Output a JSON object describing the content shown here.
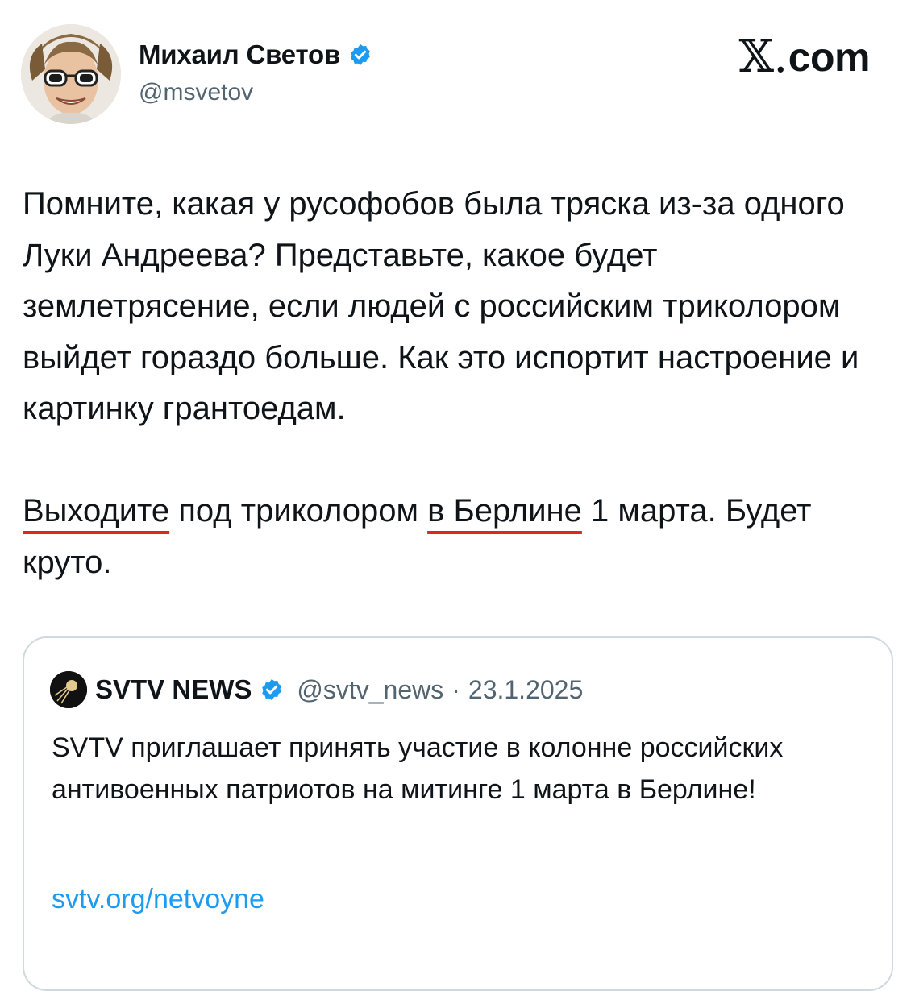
{
  "author": {
    "name": "Михаил Светов",
    "handle": "@msvetov",
    "avatar_icon": "avatar-photo",
    "verified_icon": "verified-badge-icon"
  },
  "site_label": "com",
  "site_mark": "𝕏.",
  "post": {
    "paragraph1": "Помните, какая у русофобов была тряска из-за одного Луки Андреева? Представьте, какое будет землетрясение, если людей с российским триколором выйдет гораздо больше. Как это испортит настроение и картинку грантоедам.",
    "p2_part1": "Выходите",
    "p2_part2": " под триколором ",
    "p2_part3": "в Берлине",
    "p2_part4": " 1 марта. Будет круто."
  },
  "quote": {
    "name": "SVTV NEWS",
    "handle": "@svtv_news",
    "separator": "·",
    "date": "23.1.2025",
    "text": "SVTV приглашает принять участие в колонне российских антивоенных патриотов на митинге 1 марта в Берлине!",
    "link": "svtv.org/netvoyne"
  },
  "colors": {
    "verified": "#1d9bf0",
    "link": "#1d9bf0",
    "underline": "#e0271e"
  }
}
